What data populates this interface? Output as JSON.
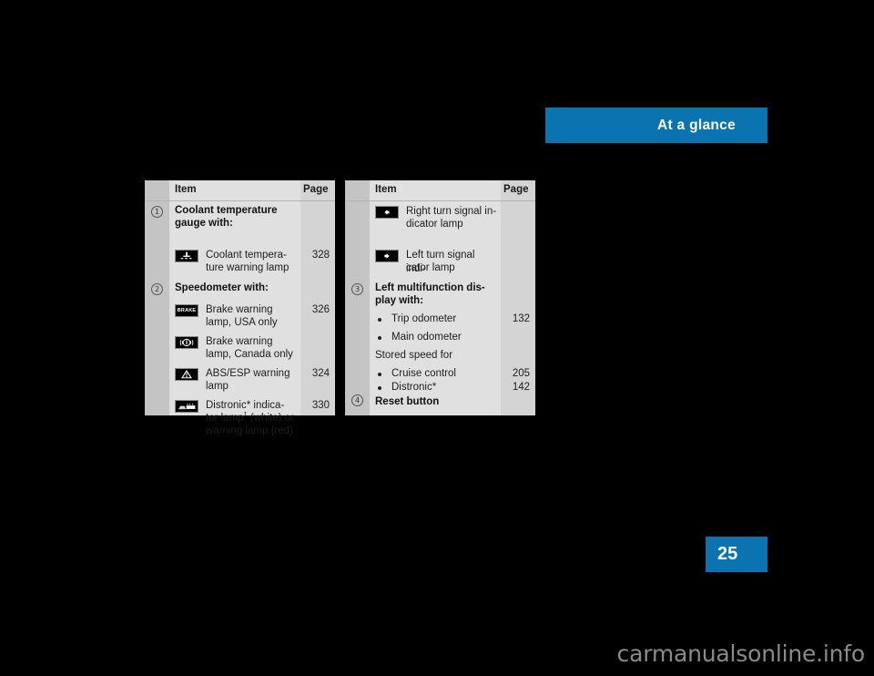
{
  "header": {
    "title": "At a glance"
  },
  "page_tab": {
    "number": "25"
  },
  "watermark": {
    "text": "carmanualsonline.info"
  },
  "colors": {
    "accent": "#0b73b0",
    "table_body": "#e0e0e0",
    "table_side": "#c4c4c4",
    "page_col": "#d4d4d4",
    "glyph": "#000000"
  },
  "tables": [
    {
      "id": "left-table",
      "headers": {
        "item": "Item",
        "page": "Page"
      },
      "rows": [
        {
          "kind": "numbered-heading",
          "number": "1",
          "text": "Coolant temperature gauge with:"
        },
        {
          "kind": "icon-row",
          "icon": "coolant-temperature-icon",
          "text": "Coolant tempera-ture warning lamp",
          "page": "328"
        },
        {
          "kind": "numbered-heading",
          "number": "2",
          "text": "Speedometer with:"
        },
        {
          "kind": "icon-row",
          "icon": "brake-warning-usa-icon",
          "text": "Brake warning lamp, USA only",
          "page": "326"
        },
        {
          "kind": "icon-row",
          "icon": "brake-warning-canada-icon",
          "text": "Brake warning lamp, Canada only",
          "page": ""
        },
        {
          "kind": "icon-row",
          "icon": "abs-esp-warning-icon",
          "text": "ABS/ESP warning lamp",
          "page": "324"
        },
        {
          "kind": "icon-row",
          "icon": "distronic-indicator-icon",
          "text": "Distronic* indica-tor lamp1 (white) or warning lamp (red)",
          "page": "330"
        }
      ]
    },
    {
      "id": "right-table",
      "headers": {
        "item": "Item",
        "page": "Page"
      },
      "rows": [
        {
          "kind": "icon-row",
          "icon": "right-turn-signal-icon",
          "text": "Right turn signal in-dicator lamp",
          "page": ""
        },
        {
          "kind": "icon-row",
          "icon": "left-turn-signal-icon",
          "text": "Left turn signal indi-cator lamp",
          "page": ""
        },
        {
          "kind": "numbered-heading",
          "number": "3",
          "text": "Left multifunction dis-play with:"
        },
        {
          "kind": "bullet",
          "text": "Trip odometer",
          "page": "132"
        },
        {
          "kind": "bullet",
          "text": "Main odometer",
          "page": ""
        },
        {
          "kind": "plain",
          "text": "Stored speed for",
          "page": ""
        },
        {
          "kind": "bullet",
          "text": "Cruise control",
          "page": "205"
        },
        {
          "kind": "bullet",
          "text": "Distronic*",
          "page": "142"
        },
        {
          "kind": "numbered-heading",
          "number": "4",
          "text": "Reset button"
        }
      ]
    }
  ],
  "left_table_text": {
    "item_header": "Item",
    "page_header": "Page",
    "r1_head_l1": "Coolant temperature",
    "r1_head_l2": "gauge with:",
    "r2_l1": "Coolant tempera-",
    "r2_l2": "ture warning lamp",
    "r2_page": "328",
    "r3_head": "Speedometer with:",
    "r4_l1": "Brake warning",
    "r4_l2": "lamp, USA only",
    "r4_page": "326",
    "r5_l1": "Brake warning",
    "r5_l2": "lamp, Canada only",
    "r6_l1": "ABS/ESP warning",
    "r6_l2": "lamp",
    "r6_page": "324",
    "r7_l1": "Distronic* indica-",
    "r7_l2a": "tor lamp",
    "r7_l2b": "1",
    "r7_l2c": " (white) or",
    "r7_l3": "warning lamp (red)",
    "r7_page": "330",
    "n1": "1",
    "n2": "2"
  },
  "right_table_text": {
    "item_header": "Item",
    "page_header": "Page",
    "r1_l1": "Right turn signal in-",
    "r1_l2": "dicator lamp",
    "r2_l1": "Left turn signal indi-",
    "r2_l2": "cator lamp",
    "r3_head_l1": "Left multifunction dis-",
    "r3_head_l2": "play with:",
    "b1": "Trip odometer",
    "b1_page": "132",
    "b2": "Main odometer",
    "p1": "Stored speed for",
    "b3": "Cruise control",
    "b3_page": "205",
    "b4": "Distronic*",
    "b4_page": "142",
    "r4_head": "Reset button",
    "n3": "3",
    "n4": "4"
  }
}
